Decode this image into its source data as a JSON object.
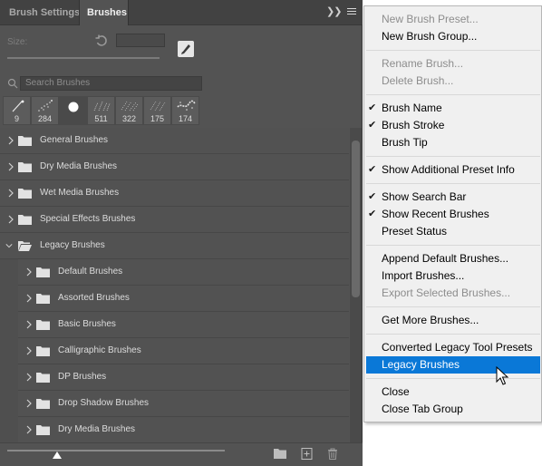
{
  "tabs": [
    {
      "label": "Brush Settings",
      "active": false
    },
    {
      "label": "Brushes",
      "active": true
    }
  ],
  "tab_controls": {
    "collapse_icon": "double-chevron-right-icon",
    "menu_icon": "hamburger-menu-icon"
  },
  "brush_size": {
    "label": "Size:",
    "value": ""
  },
  "search": {
    "placeholder": "Search Brushes",
    "value": ""
  },
  "recent_brushes": [
    {
      "size": "9"
    },
    {
      "size": "284"
    },
    {
      "size": ""
    },
    {
      "size": "511"
    },
    {
      "size": "322"
    },
    {
      "size": "175"
    },
    {
      "size": "174"
    }
  ],
  "brush_groups": [
    {
      "label": "General Brushes",
      "expanded": false,
      "level": 0
    },
    {
      "label": "Dry Media Brushes",
      "expanded": false,
      "level": 0
    },
    {
      "label": "Wet Media Brushes",
      "expanded": false,
      "level": 0
    },
    {
      "label": "Special Effects Brushes",
      "expanded": false,
      "level": 0
    },
    {
      "label": "Legacy Brushes",
      "expanded": true,
      "level": 0
    },
    {
      "label": "Default Brushes",
      "expanded": false,
      "level": 1
    },
    {
      "label": "Assorted Brushes",
      "expanded": false,
      "level": 1
    },
    {
      "label": "Basic Brushes",
      "expanded": false,
      "level": 1
    },
    {
      "label": "Calligraphic Brushes",
      "expanded": false,
      "level": 1
    },
    {
      "label": "DP Brushes",
      "expanded": false,
      "level": 1
    },
    {
      "label": "Drop Shadow Brushes",
      "expanded": false,
      "level": 1
    },
    {
      "label": "Dry Media Brushes",
      "expanded": false,
      "level": 1
    }
  ],
  "bottom_toolbar": {
    "icons": [
      "new-group-folder-icon",
      "new-brush-icon",
      "trash-icon"
    ]
  },
  "menu": {
    "items": [
      {
        "label": "New Brush Preset...",
        "disabled": true,
        "checked": false
      },
      {
        "label": "New Brush Group...",
        "disabled": false,
        "checked": false
      },
      {
        "label": "Rename Brush...",
        "disabled": true,
        "checked": false
      },
      {
        "label": "Delete Brush...",
        "disabled": true,
        "checked": false
      },
      {
        "label": "Brush Name",
        "disabled": false,
        "checked": true
      },
      {
        "label": "Brush Stroke",
        "disabled": false,
        "checked": true
      },
      {
        "label": "Brush Tip",
        "disabled": false,
        "checked": false
      },
      {
        "label": "Show Additional Preset Info",
        "disabled": false,
        "checked": true
      },
      {
        "label": "Show Search Bar",
        "disabled": false,
        "checked": true
      },
      {
        "label": "Show Recent Brushes",
        "disabled": false,
        "checked": true
      },
      {
        "label": "Preset Status",
        "disabled": false,
        "checked": false
      },
      {
        "label": "Append Default Brushes...",
        "disabled": false,
        "checked": false
      },
      {
        "label": "Import Brushes...",
        "disabled": false,
        "checked": false
      },
      {
        "label": "Export Selected Brushes...",
        "disabled": true,
        "checked": false
      },
      {
        "label": "Get More Brushes...",
        "disabled": false,
        "checked": false
      },
      {
        "label": "Converted Legacy Tool Presets",
        "disabled": false,
        "checked": false
      },
      {
        "label": "Legacy Brushes",
        "disabled": false,
        "checked": false,
        "highlighted": true
      },
      {
        "label": "Close",
        "disabled": false,
        "checked": false
      },
      {
        "label": "Close Tab Group",
        "disabled": false,
        "checked": false
      }
    ],
    "check_glyph": "✔"
  },
  "colors": {
    "panel_bg": "#535353",
    "menu_bg": "#f0f0f0",
    "menu_highlight": "#0a78d7",
    "disabled_text": "#8d8d8d"
  }
}
